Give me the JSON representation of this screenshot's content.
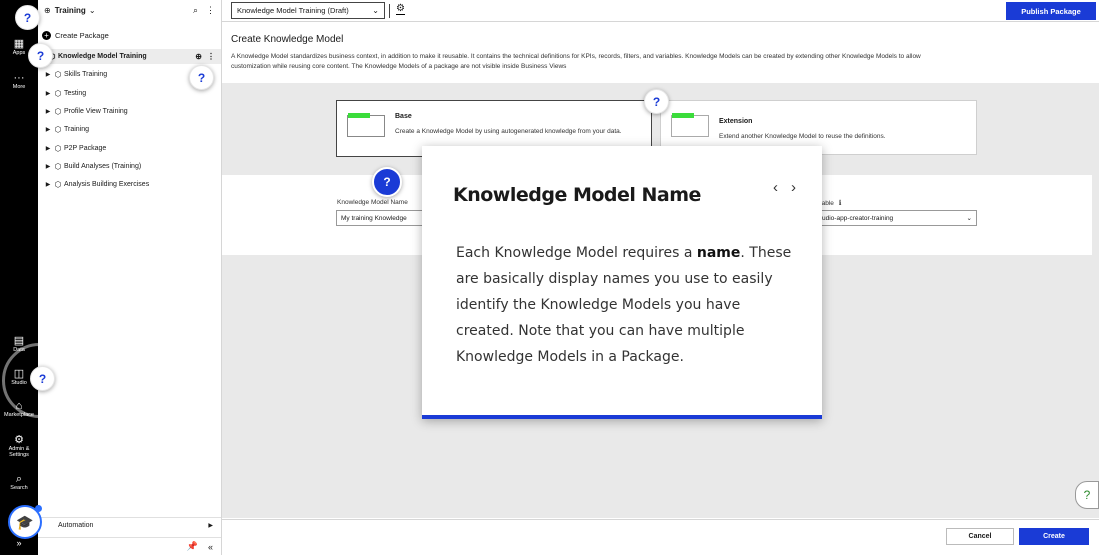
{
  "rail": {
    "items": [
      {
        "label": "Apps",
        "icon": "grid-icon"
      },
      {
        "label": "More",
        "icon": "more-icon"
      },
      {
        "label": "Data",
        "icon": "data-icon"
      },
      {
        "label": "Studio",
        "icon": "studio-icon"
      },
      {
        "label": "Marketplace",
        "icon": "marketplace-icon"
      },
      {
        "label": "Admin & Settings",
        "icon": "settings-icon"
      },
      {
        "label": "Search",
        "icon": "search-icon"
      }
    ]
  },
  "help_marker": "?",
  "tree": {
    "group_name": "Training",
    "create_package": "Create Package",
    "nodes": [
      "Knowledge Model Training",
      "Skills Training",
      "Testing",
      "Profile View Training",
      "Training",
      "P2P Package",
      "Build Analyses (Training)",
      "Analysis Building Exercises"
    ],
    "automation": "Automation"
  },
  "topbar": {
    "package_select": "Knowledge Model Training (Draft)",
    "publish": "Publish Package"
  },
  "main": {
    "title": "Create Knowledge Model",
    "description": "A Knowledge Model standardizes business context, in addition to make it reusable. It contains the technical definitions for KPIs, records, filters, and variables. Knowledge Models can be created by extending other Knowledge Models to allow customization while reusing core content. The Knowledge Models of a package are not visible inside Business Views",
    "options": [
      {
        "title": "Base",
        "desc": "Create a Knowledge Model by using autogenerated knowledge from your data."
      },
      {
        "title": "Extension",
        "desc": "Extend another Knowledge Model to reuse the definitions."
      }
    ],
    "name_label": "Knowledge Model Name",
    "name_value": "My training Knowledge",
    "variable_label": "riable",
    "variable_value": "udio-app-creator-training",
    "cancel": "Cancel",
    "create": "Create"
  },
  "tooltip": {
    "title": "Knowledge Model Name",
    "body_pre": "Each Knowledge Model requires a ",
    "body_bold": "name",
    "body_post": ". These are basically display names you use to easily identify the Knowledge Models you have created. Note that you can have multiple Knowledge Models in a Package."
  },
  "colors": {
    "accent": "#1a3bd6",
    "highlight": "#3bdc3b",
    "rail": "#000000"
  }
}
